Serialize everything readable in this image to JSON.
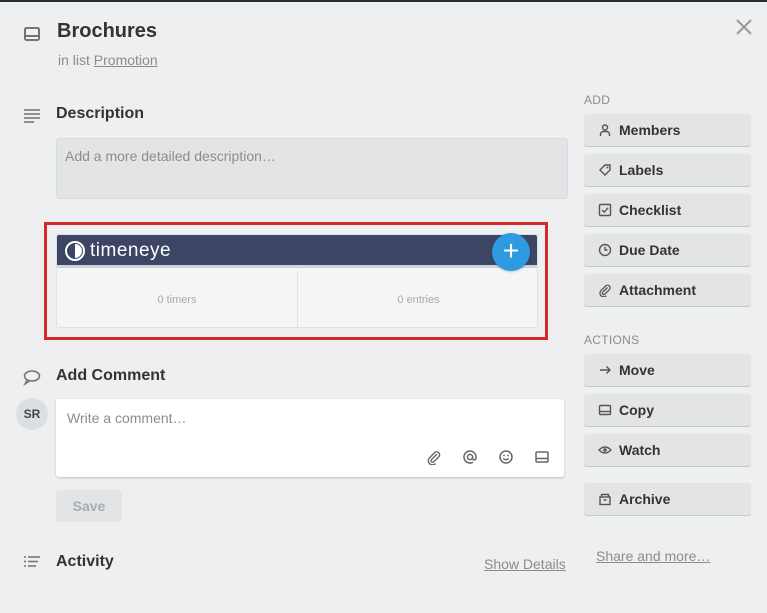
{
  "card": {
    "title": "Brochures",
    "in_list_prefix": "in list",
    "list_name": "Promotion"
  },
  "description": {
    "title": "Description",
    "placeholder": "Add a more detailed description…"
  },
  "timeneye": {
    "logo_text": "timeneye",
    "add_symbol": "+",
    "timers": "0 timers",
    "entries": "0 entries",
    "brand_color": "#3c4563",
    "accent_color": "#2e9be0",
    "highlight_color": "#d42a2a"
  },
  "comment": {
    "title": "Add Comment",
    "avatar_initials": "SR",
    "placeholder": "Write a comment…",
    "tools": [
      "paperclip-icon",
      "at-icon",
      "smiley-icon",
      "card-icon"
    ],
    "save_label": "Save"
  },
  "activity": {
    "title": "Activity",
    "show_details": "Show Details"
  },
  "sidebar": {
    "add_label": "ADD",
    "add_buttons": [
      {
        "label": "Members",
        "icon": "person-icon"
      },
      {
        "label": "Labels",
        "icon": "tag-icon"
      },
      {
        "label": "Checklist",
        "icon": "checkbox-icon"
      },
      {
        "label": "Due Date",
        "icon": "clock-icon"
      },
      {
        "label": "Attachment",
        "icon": "paperclip-icon"
      }
    ],
    "actions_label": "ACTIONS",
    "action_buttons": [
      {
        "label": "Move",
        "icon": "arrow-right-icon"
      },
      {
        "label": "Copy",
        "icon": "card-icon"
      },
      {
        "label": "Watch",
        "icon": "eye-icon"
      },
      {
        "label": "Archive",
        "icon": "archive-icon"
      }
    ],
    "share_label": "Share and more…"
  }
}
